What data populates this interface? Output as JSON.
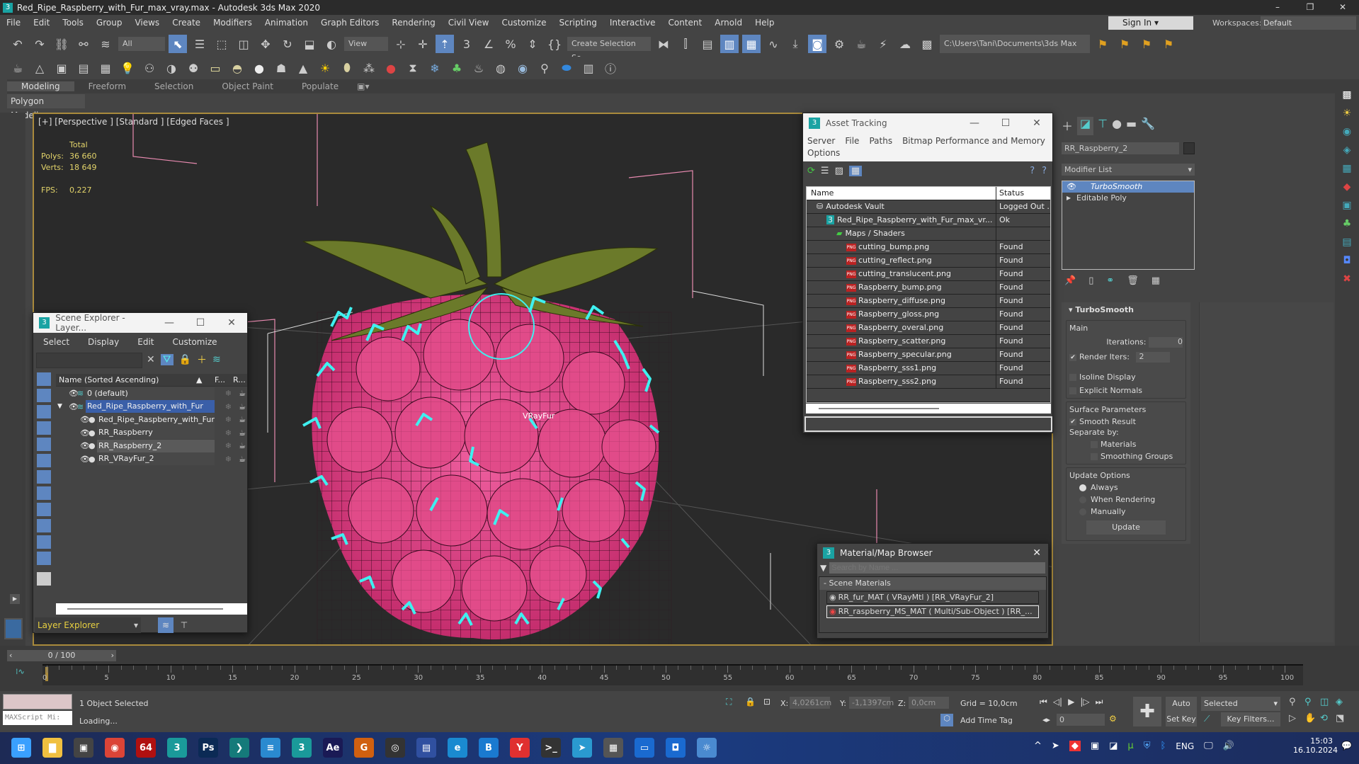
{
  "window": {
    "title": "Red_Ripe_Raspberry_with_Fur_max_vray.max - Autodesk 3ds Max 2020",
    "controls": [
      "–",
      "❐",
      "✕"
    ]
  },
  "menu": [
    "File",
    "Edit",
    "Tools",
    "Group",
    "Views",
    "Create",
    "Modifiers",
    "Animation",
    "Graph Editors",
    "Rendering",
    "Civil View",
    "Customize",
    "Scripting",
    "Interactive",
    "Content",
    "Arnold",
    "Help"
  ],
  "account": {
    "sign_in": "Sign In",
    "workspaces_label": "Workspaces:",
    "workspace": "Default"
  },
  "toolbar1": {
    "filter": "All",
    "ref_coord": "View",
    "selection_set": "Create Selection Se",
    "project_path": "C:\\Users\\Tani\\Documents\\3ds Max 2020"
  },
  "ribbon": {
    "tabs": [
      "Modeling",
      "Freeform",
      "Selection",
      "Object Paint",
      "Populate"
    ],
    "active": "Modeling",
    "panel": "Polygon Modeling"
  },
  "viewport": {
    "label": "[+] [Perspective ] [Standard ] [Edged Faces ]",
    "stats_header": "Total",
    "polys_label": "Polys:",
    "polys": "36 660",
    "verts_label": "Verts:",
    "verts": "18 649",
    "fps_label": "FPS:",
    "fps": "0,227",
    "object_label": "VRayFur"
  },
  "scene_explorer": {
    "title": "Scene Explorer - Layer...",
    "menu": [
      "Select",
      "Display",
      "Edit",
      "Customize"
    ],
    "col_name": "Name (Sorted Ascending)",
    "col_f": "F...",
    "col_r": "R...",
    "rows": [
      {
        "name": "0 (default)",
        "level": 0
      },
      {
        "name": "Red_Ripe_Raspberry_with_Fur",
        "level": 0,
        "selected": true
      },
      {
        "name": "Red_Ripe_Raspberry_with_Fur",
        "level": 1
      },
      {
        "name": "RR_Raspberry",
        "level": 1
      },
      {
        "name": "RR_Raspberry_2",
        "level": 1,
        "highlight": true
      },
      {
        "name": "RR_VRayFur_2",
        "level": 1
      }
    ],
    "explorer_mode": "Layer Explorer"
  },
  "asset_tracking": {
    "title": "Asset Tracking",
    "menu": [
      "Server",
      "File",
      "Paths",
      "Bitmap Performance and Memory",
      "Options"
    ],
    "col_name": "Name",
    "col_status": "Status",
    "rows": [
      {
        "name": "Autodesk Vault",
        "status": "Logged Out ..",
        "indent": 1
      },
      {
        "name": "Red_Ripe_Raspberry_with_Fur_max_vr...",
        "status": "Ok",
        "indent": 2
      },
      {
        "name": "Maps / Shaders",
        "status": "",
        "indent": 3
      },
      {
        "name": "cutting_bump.png",
        "status": "Found",
        "indent": 4
      },
      {
        "name": "cutting_reflect.png",
        "status": "Found",
        "indent": 4
      },
      {
        "name": "cutting_translucent.png",
        "status": "Found",
        "indent": 4
      },
      {
        "name": "Raspberry_bump.png",
        "status": "Found",
        "indent": 4
      },
      {
        "name": "Raspberry_diffuse.png",
        "status": "Found",
        "indent": 4
      },
      {
        "name": "Raspberry_gloss.png",
        "status": "Found",
        "indent": 4
      },
      {
        "name": "Raspberry_overal.png",
        "status": "Found",
        "indent": 4
      },
      {
        "name": "Raspberry_scatter.png",
        "status": "Found",
        "indent": 4
      },
      {
        "name": "Raspberry_specular.png",
        "status": "Found",
        "indent": 4
      },
      {
        "name": "Raspberry_sss1.png",
        "status": "Found",
        "indent": 4
      },
      {
        "name": "Raspberry_sss2.png",
        "status": "Found",
        "indent": 4
      }
    ],
    "png_badge": "PNG"
  },
  "command_panel": {
    "object_name": "RR_Raspberry_2",
    "modifier_list": "Modifier List",
    "stack": [
      "TurboSmooth",
      "Editable Poly"
    ],
    "turbosmooth": {
      "title": "TurboSmooth",
      "main": "Main",
      "iterations_label": "Iterations:",
      "iterations": "0",
      "render_iters_label": "Render Iters:",
      "render_iters": "2",
      "render_iters_checked": true,
      "isoline": "Isoline Display",
      "explicit_normals": "Explicit Normals",
      "surface_params": "Surface Parameters",
      "smooth_result": "Smooth Result",
      "smooth_result_checked": true,
      "separate_by": "Separate by:",
      "materials": "Materials",
      "smoothing_groups": "Smoothing Groups",
      "update_options": "Update Options",
      "always": "Always",
      "when_rendering": "When Rendering",
      "manually": "Manually",
      "update_option_selected": "Always",
      "update_btn": "Update"
    }
  },
  "material_browser": {
    "title": "Material/Map Browser",
    "search_placeholder": "Search by Name ...",
    "group": "- Scene Materials",
    "items": [
      "RR_fur_MAT ( VRayMtl ) [RR_VRayFur_2]",
      "RR_raspberry_MS_MAT ( Multi/Sub-Object ) [RR_..."
    ]
  },
  "timeline": {
    "frame": "0 / 100",
    "ticks": [
      "0",
      "5",
      "10",
      "15",
      "20",
      "25",
      "30",
      "35",
      "40",
      "45",
      "50",
      "55",
      "60",
      "65",
      "70",
      "75",
      "80",
      "85",
      "90",
      "95",
      "100"
    ]
  },
  "status": {
    "selection": "1 Object Selected",
    "prompt": "Loading...",
    "maxscript": "MAXScript Mi:",
    "x_label": "X:",
    "x": "4,0261cm",
    "y_label": "Y:",
    "y": "-1,1397cm",
    "z_label": "Z:",
    "z": "0,0cm",
    "grid": "Grid = 10,0cm",
    "add_time_tag": "Add Time Tag",
    "auto_key": "Auto Key",
    "set_key": "Set Key",
    "key_mode": "Selected",
    "key_filters": "Key Filters...",
    "current_frame": "0"
  },
  "taskbar": {
    "apps": [
      {
        "icon": "windows-start-icon",
        "glyph": "⊞",
        "color": "#3aa0ff"
      },
      {
        "icon": "file-explorer-icon",
        "glyph": "▇",
        "color": "#f0c040"
      },
      {
        "icon": "task-view-icon",
        "glyph": "▣",
        "color": "#444"
      },
      {
        "icon": "chrome-icon",
        "glyph": "◉",
        "color": "#db4437"
      },
      {
        "icon": "app-64-icon",
        "glyph": "64",
        "color": "#b01010"
      },
      {
        "icon": "3dsmax-icon",
        "glyph": "3",
        "color": "#1a9a9a"
      },
      {
        "icon": "photoshop-icon",
        "glyph": "Ps",
        "color": "#0b2a55"
      },
      {
        "icon": "3dsmax-alt-icon",
        "glyph": "❯",
        "color": "#157a7a"
      },
      {
        "icon": "notepad-icon",
        "glyph": "≡",
        "color": "#2a8ad0"
      },
      {
        "icon": "3dsmax-active-icon",
        "glyph": "3",
        "color": "#1a9a9a"
      },
      {
        "icon": "after-effects-icon",
        "glyph": "Ae",
        "color": "#1a1a55"
      },
      {
        "icon": "g-app-icon",
        "glyph": "G",
        "color": "#d06010"
      },
      {
        "icon": "search-app-icon",
        "glyph": "◎",
        "color": "#333"
      },
      {
        "icon": "save-app-icon",
        "glyph": "▤",
        "color": "#3050a0"
      },
      {
        "icon": "edge-icon",
        "glyph": "e",
        "color": "#1a8ad0"
      },
      {
        "icon": "b-app-icon",
        "glyph": "B",
        "color": "#1a7ad0"
      },
      {
        "icon": "yandex-icon",
        "glyph": "Y",
        "color": "#e03030"
      },
      {
        "icon": "terminal-icon",
        "glyph": ">_",
        "color": "#333"
      },
      {
        "icon": "telegram-icon",
        "glyph": "➤",
        "color": "#2a9ad0"
      },
      {
        "icon": "calculator-icon",
        "glyph": "▦",
        "color": "#555"
      },
      {
        "icon": "video-app-icon",
        "glyph": "▭",
        "color": "#1a6ad0"
      },
      {
        "icon": "camera-app-icon",
        "glyph": "◘",
        "color": "#1a6ad0"
      },
      {
        "icon": "weather-app-icon",
        "glyph": "☼",
        "color": "#4a8ad0"
      }
    ],
    "lang": "ENG",
    "time": "15:03",
    "date": "16.10.2024"
  },
  "colors": {
    "accent": "#5e86c0",
    "viewport_border": "#a98a3c",
    "raspberry": "#e0487e",
    "fur": "#3ff0f0",
    "stats": "#e2d36a"
  }
}
